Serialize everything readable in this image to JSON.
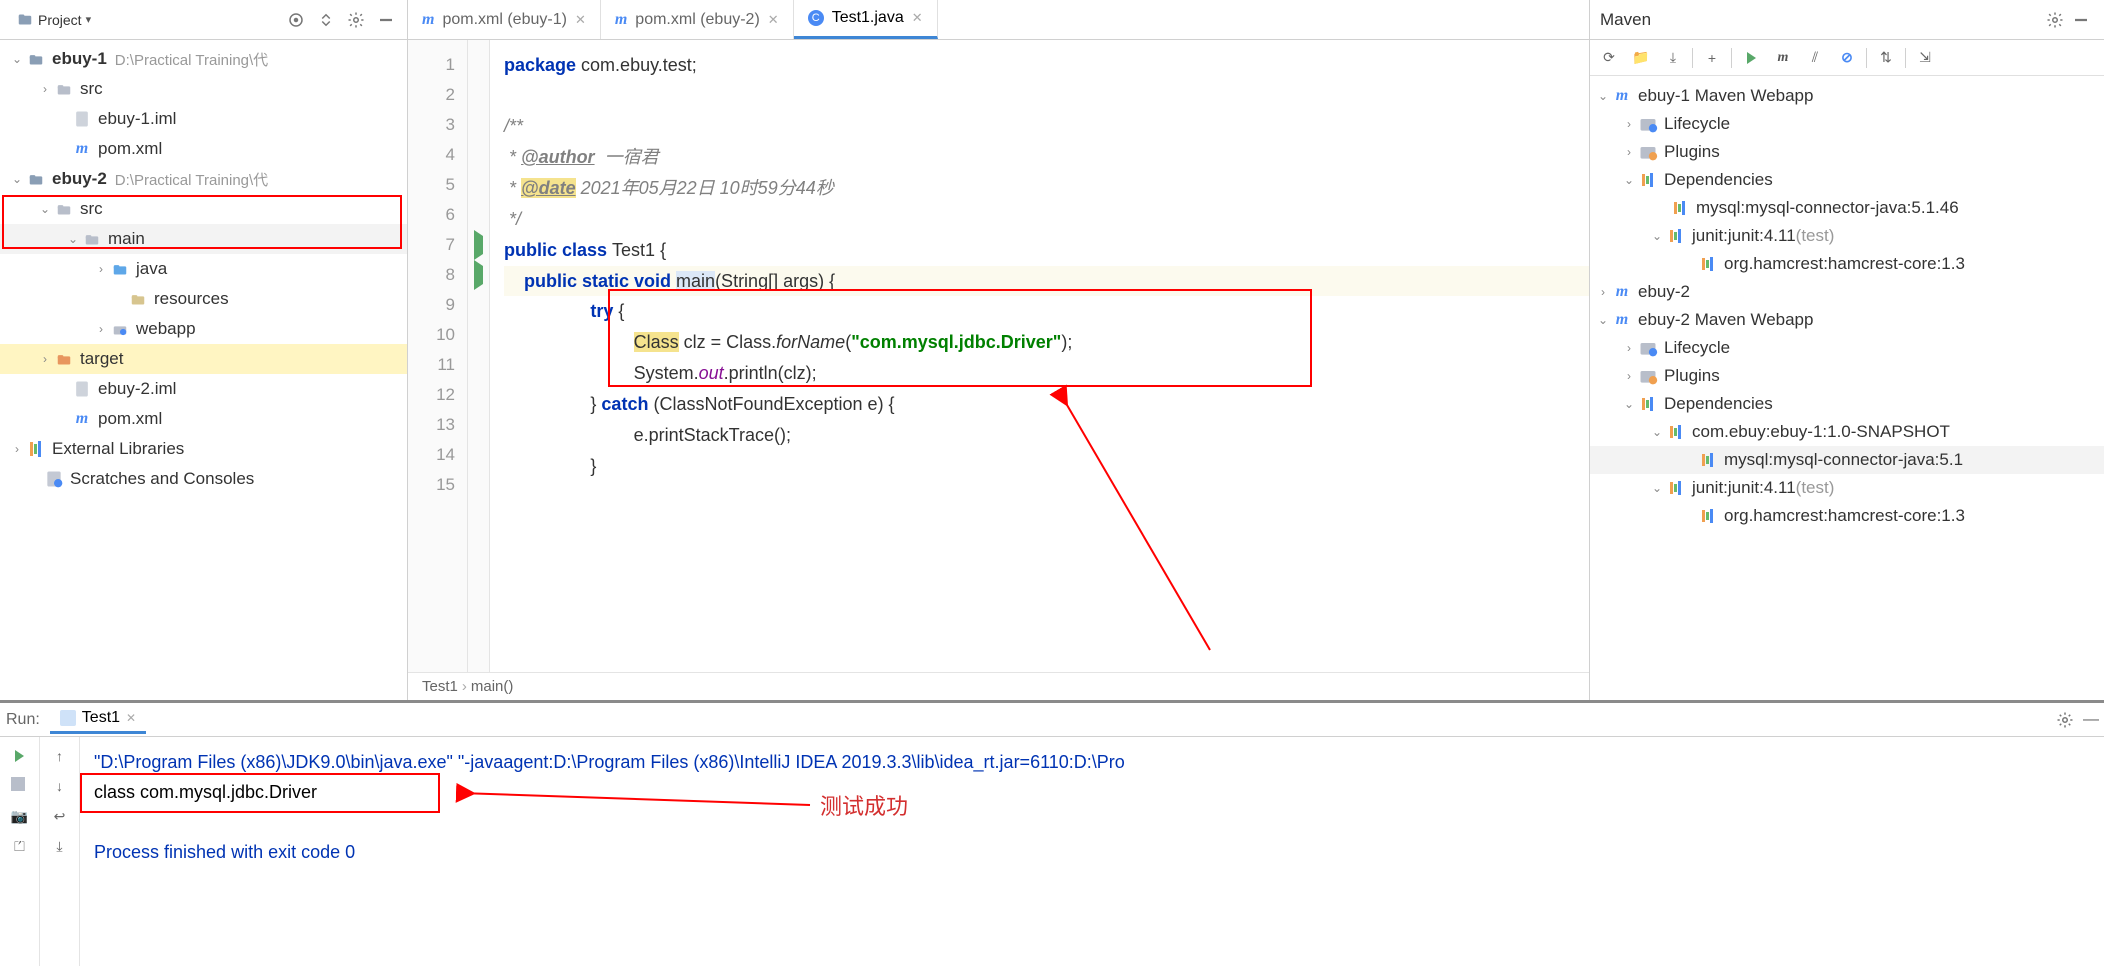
{
  "project": {
    "panel_label": "Project",
    "nodes": {
      "ebuy1": "ebuy-1",
      "ebuy1_loc": "D:\\Practical Training\\代",
      "ebuy2": "ebuy-2",
      "ebuy2_loc": "D:\\Practical Training\\代",
      "src": "src",
      "main": "main",
      "java": "java",
      "resources": "resources",
      "webapp": "webapp",
      "target": "target",
      "ebuy1_iml": "ebuy-1.iml",
      "ebuy2_iml": "ebuy-2.iml",
      "pom": "pom.xml",
      "ext_lib": "External Libraries",
      "scratches": "Scratches and Consoles"
    }
  },
  "tabs": {
    "t1": "pom.xml (ebuy-1)",
    "t2": "pom.xml (ebuy-2)",
    "t3": "Test1.java"
  },
  "gutter_lines": [
    "1",
    "2",
    "3",
    "4",
    "5",
    "6",
    "7",
    "8",
    "9",
    "10",
    "11",
    "12",
    "13",
    "14",
    "15"
  ],
  "code": {
    "l1a": "package",
    "l1b": " com.ebuy.test;",
    "l3": "/**",
    "l4a": " * ",
    "l4tag": "@author",
    "l4b": "  一宿君",
    "l5a": " * ",
    "l5tag": "@date",
    "l5b": " 2021年05月22日 10时59分44秒",
    "l6": " */",
    "l7a": "public class ",
    "l7b": "Test1 {",
    "l8a": "public static void ",
    "l8b": "main",
    "l8c": "(String[] args) {",
    "l9a": "try ",
    "l9b": "{",
    "l10a": "Class",
    "l10b": " clz = Class.",
    "l10c": "forName",
    "l10d": "(",
    "l10e": "\"com.mysql.jdbc.Driver\"",
    "l10f": ");",
    "l11a": "System.",
    "l11b": "out",
    "l11c": ".println(clz);",
    "l12a": "} ",
    "l12b": "catch ",
    "l12c": "(ClassNotFoundException e) {",
    "l13": "e.printStackTrace();",
    "l14": "}"
  },
  "breadcrumb": {
    "a": "Test1",
    "b": "main()"
  },
  "maven": {
    "title": "Maven",
    "n": {
      "w1": "ebuy-1 Maven Webapp",
      "lifecycle": "Lifecycle",
      "plugins": "Plugins",
      "deps": "Dependencies",
      "mysql46": "mysql:mysql-connector-java:5.1.46",
      "junit": "junit:junit:4.11",
      "junit_note": " (test)",
      "hamcrest": "org.hamcrest:hamcrest-core:1.3",
      "ebuy2": "ebuy-2",
      "w2": "ebuy-2 Maven Webapp",
      "ebuy_dep": "com.ebuy:ebuy-1:1.0-SNAPSHOT",
      "mysql51": "mysql:mysql-connector-java:5.1"
    }
  },
  "run": {
    "label": "Run:",
    "tab": "Test1",
    "line1": "\"D:\\Program Files (x86)\\JDK9.0\\bin\\java.exe\" \"-javaagent:D:\\Program Files (x86)\\IntelliJ IDEA 2019.3.3\\lib\\idea_rt.jar=6110:D:\\Pro",
    "line2": "class com.mysql.jdbc.Driver",
    "line3": "Process finished with exit code 0"
  },
  "annotation": "测试成功"
}
